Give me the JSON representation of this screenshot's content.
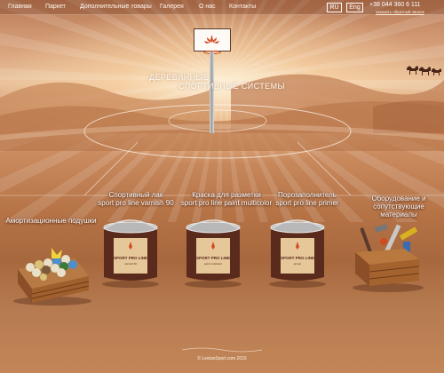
{
  "nav": {
    "items": [
      "Главная",
      "Паркет",
      "Дополнительные товары",
      "Галерея",
      "О нас",
      "Контакты"
    ],
    "languages": [
      "RU",
      "Eng"
    ],
    "phone": "+38 044 360 6 111",
    "callback": "заказать обратный звонок"
  },
  "hero": {
    "title_line1": "ДЕРЕВЯННЫЕ",
    "title_line2": "СПОРТИВНЫЕ СИСТЕМЫ"
  },
  "products": [
    {
      "title": "Спортивный лак",
      "subtitle": "sport pro line varnish 90"
    },
    {
      "title": "Краска для разметки",
      "subtitle": "sport pro line paint multicolor"
    },
    {
      "title": "Порозаполнитель",
      "subtitle": "sport pro line primer"
    },
    {
      "title": "Оборудование и сопутствующие материалы",
      "subtitle": ""
    },
    {
      "title": "Амортизационные подушки",
      "subtitle": ""
    }
  ],
  "cans": [
    {
      "brand": "SPORT PRO LINE",
      "name": "varnish 90"
    },
    {
      "brand": "SPORT PRO LINE",
      "name": "paint multicolor"
    },
    {
      "brand": "SPORT PRO LINE",
      "name": "primer"
    }
  ],
  "footer": "© LestanSport.com 2015",
  "colors": {
    "accent": "#d24a20",
    "can_body": "#5a2a1c",
    "nav_text": "#fff6ee"
  }
}
